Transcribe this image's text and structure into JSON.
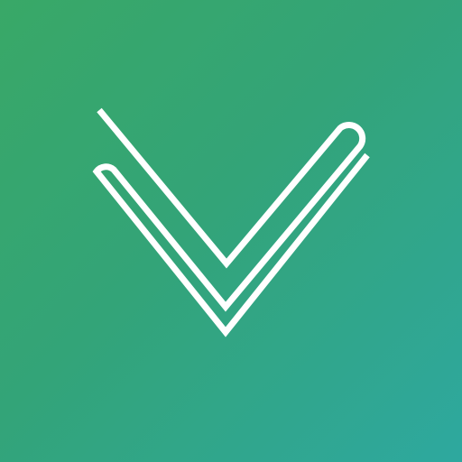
{
  "icon": {
    "name": "v-chevron-logo",
    "background_colors": [
      "#39a867",
      "#33a478",
      "#2ea89f"
    ],
    "stroke_color": "#ffffff"
  }
}
